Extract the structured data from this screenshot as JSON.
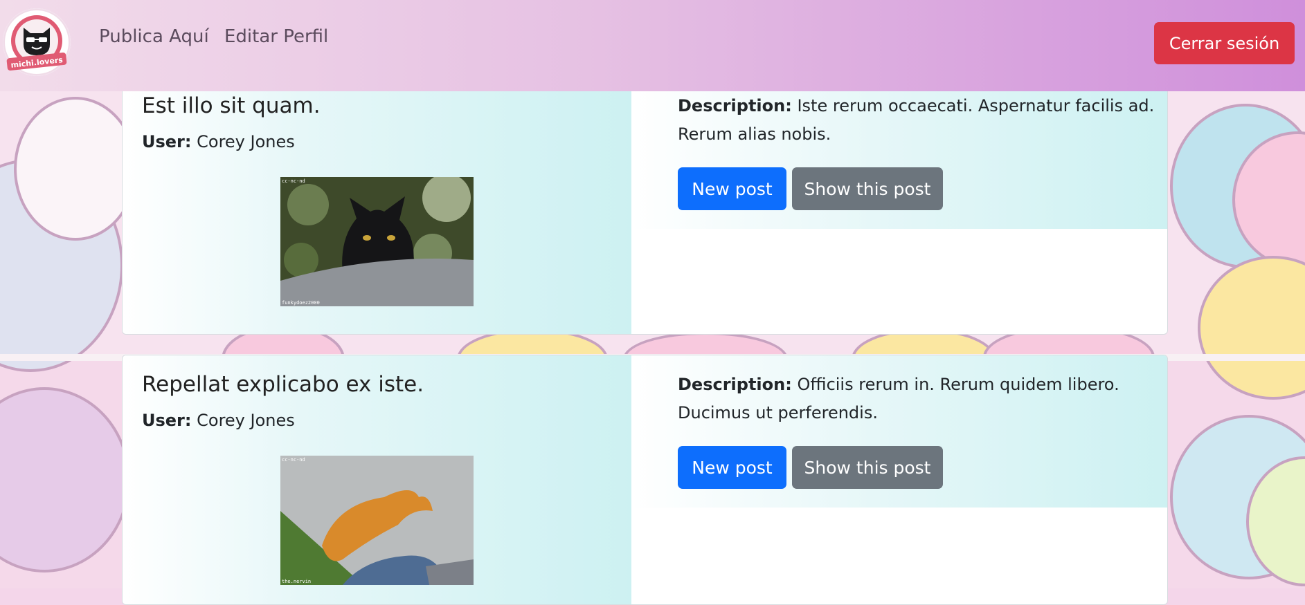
{
  "brand": {
    "logo_text": "michi.lovers"
  },
  "nav": {
    "links": [
      "Publica Aquí",
      "Editar Perfil"
    ],
    "logout_label": "Cerrar sesión"
  },
  "labels": {
    "user": "User:",
    "description": "Description:"
  },
  "posts": [
    {
      "title": "Est illo sit quam.",
      "user": "Corey Jones",
      "description": "Iste rerum occaecati. Aspernatur facilis ad. Rerum alias nobis.",
      "image_caption_top": "cc-nc-nd",
      "image_caption_bottom": "funkydoez2000",
      "new_label": "New post",
      "show_label": "Show this post"
    },
    {
      "title": "Repellat explicabo ex iste.",
      "user": "Corey Jones",
      "description": "Officiis rerum in. Rerum quidem libero. Ducimus ut perferendis.",
      "image_caption_top": "cc-nc-nd",
      "image_caption_bottom": "the.nervin",
      "new_label": "New post",
      "show_label": "Show this post"
    }
  ],
  "colors": {
    "nav_gradient_start": "#f2dcea",
    "nav_gradient_end": "#cf8fdb",
    "primary": "#0d6efd",
    "secondary": "#6c757d",
    "danger": "#dc3545"
  }
}
